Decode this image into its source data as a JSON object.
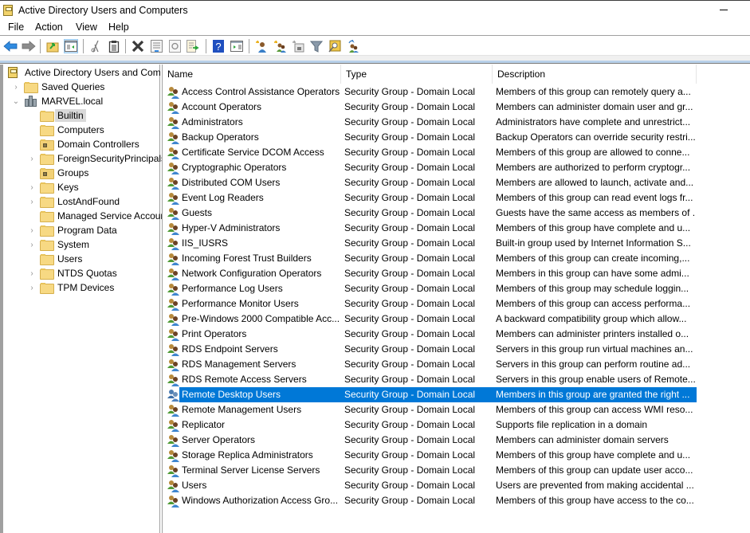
{
  "window": {
    "title": "Active Directory Users and Computers",
    "app_icon": "mmc-console-icon",
    "minimize_icon": "minimize-icon"
  },
  "menubar": {
    "items": [
      "File",
      "Action",
      "View",
      "Help"
    ]
  },
  "toolbar": {
    "buttons": [
      {
        "name": "back",
        "icon": "back-arrow-icon"
      },
      {
        "name": "forward",
        "icon": "forward-arrow-icon"
      },
      {
        "name": "up-one-level",
        "icon": "up-folder-icon"
      },
      {
        "name": "show-hide-console-tree",
        "icon": "console-tree-icon",
        "pressed": true
      },
      {
        "name": "cut",
        "icon": "scissors-icon"
      },
      {
        "name": "copy",
        "icon": "clipboard-icon"
      },
      {
        "name": "delete",
        "icon": "delete-x-icon"
      },
      {
        "name": "properties",
        "icon": "properties-icon"
      },
      {
        "name": "refresh",
        "icon": "refresh-icon"
      },
      {
        "name": "export-list",
        "icon": "export-list-icon"
      },
      {
        "name": "help",
        "icon": "help-icon"
      },
      {
        "name": "show-hide-action-pane",
        "icon": "action-pane-icon"
      },
      {
        "name": "create-user",
        "icon": "new-user-icon"
      },
      {
        "name": "create-group",
        "icon": "new-group-icon"
      },
      {
        "name": "create-ou",
        "icon": "new-ou-icon"
      },
      {
        "name": "filter",
        "icon": "filter-funnel-icon"
      },
      {
        "name": "find",
        "icon": "find-icon"
      },
      {
        "name": "add-to-group",
        "icon": "add-to-group-icon"
      }
    ]
  },
  "tree": {
    "root": "Active Directory Users and Com",
    "saved_queries": "Saved Queries",
    "domain": "MARVEL.local",
    "children": [
      {
        "label": "Builtin",
        "type": "container",
        "expandable": false,
        "selected": true
      },
      {
        "label": "Computers",
        "type": "container",
        "expandable": false
      },
      {
        "label": "Domain Controllers",
        "type": "ou",
        "expandable": false
      },
      {
        "label": "ForeignSecurityPrincipals",
        "type": "container",
        "expandable": true
      },
      {
        "label": "Groups",
        "type": "ou",
        "expandable": false
      },
      {
        "label": "Keys",
        "type": "container",
        "expandable": true
      },
      {
        "label": "LostAndFound",
        "type": "container",
        "expandable": true
      },
      {
        "label": "Managed Service Accour",
        "type": "container",
        "expandable": false
      },
      {
        "label": "Program Data",
        "type": "container",
        "expandable": true
      },
      {
        "label": "System",
        "type": "container",
        "expandable": true
      },
      {
        "label": "Users",
        "type": "container",
        "expandable": false
      },
      {
        "label": "NTDS Quotas",
        "type": "container",
        "expandable": true
      },
      {
        "label": "TPM Devices",
        "type": "container",
        "expandable": true
      }
    ]
  },
  "list": {
    "columns": [
      "Name",
      "Type",
      "Description"
    ],
    "selected_index": 20,
    "rows": [
      {
        "name": "Access Control Assistance Operators",
        "type": "Security Group - Domain Local",
        "description": "Members of this group can remotely query a..."
      },
      {
        "name": "Account Operators",
        "type": "Security Group - Domain Local",
        "description": "Members can administer domain user and gr..."
      },
      {
        "name": "Administrators",
        "type": "Security Group - Domain Local",
        "description": "Administrators have complete and unrestrict..."
      },
      {
        "name": "Backup Operators",
        "type": "Security Group - Domain Local",
        "description": "Backup Operators can override security restri..."
      },
      {
        "name": "Certificate Service DCOM Access",
        "type": "Security Group - Domain Local",
        "description": "Members of this group are allowed to conne..."
      },
      {
        "name": "Cryptographic Operators",
        "type": "Security Group - Domain Local",
        "description": "Members are authorized to perform cryptogr..."
      },
      {
        "name": "Distributed COM Users",
        "type": "Security Group - Domain Local",
        "description": "Members are allowed to launch, activate and..."
      },
      {
        "name": "Event Log Readers",
        "type": "Security Group - Domain Local",
        "description": "Members of this group can read event logs fr..."
      },
      {
        "name": "Guests",
        "type": "Security Group - Domain Local",
        "description": "Guests have the same access as members of ..."
      },
      {
        "name": "Hyper-V Administrators",
        "type": "Security Group - Domain Local",
        "description": "Members of this group have complete and u..."
      },
      {
        "name": "IIS_IUSRS",
        "type": "Security Group - Domain Local",
        "description": "Built-in group used by Internet Information S..."
      },
      {
        "name": "Incoming Forest Trust Builders",
        "type": "Security Group - Domain Local",
        "description": "Members of this group can create incoming,..."
      },
      {
        "name": "Network Configuration Operators",
        "type": "Security Group - Domain Local",
        "description": "Members in this group can have some admi..."
      },
      {
        "name": "Performance Log Users",
        "type": "Security Group - Domain Local",
        "description": "Members of this group may schedule loggin..."
      },
      {
        "name": "Performance Monitor Users",
        "type": "Security Group - Domain Local",
        "description": "Members of this group can access performa..."
      },
      {
        "name": "Pre-Windows 2000 Compatible Acc...",
        "type": "Security Group - Domain Local",
        "description": "A backward compatibility group which allow..."
      },
      {
        "name": "Print Operators",
        "type": "Security Group - Domain Local",
        "description": "Members can administer printers installed o..."
      },
      {
        "name": "RDS Endpoint Servers",
        "type": "Security Group - Domain Local",
        "description": "Servers in this group run virtual machines an..."
      },
      {
        "name": "RDS Management Servers",
        "type": "Security Group - Domain Local",
        "description": "Servers in this group can perform routine ad..."
      },
      {
        "name": "RDS Remote Access Servers",
        "type": "Security Group - Domain Local",
        "description": "Servers in this group enable users of Remote..."
      },
      {
        "name": "Remote Desktop Users",
        "type": "Security Group - Domain Local",
        "description": "Members in this group are granted the right ..."
      },
      {
        "name": "Remote Management Users",
        "type": "Security Group - Domain Local",
        "description": "Members of this group can access WMI reso..."
      },
      {
        "name": "Replicator",
        "type": "Security Group - Domain Local",
        "description": "Supports file replication in a domain"
      },
      {
        "name": "Server Operators",
        "type": "Security Group - Domain Local",
        "description": "Members can administer domain servers"
      },
      {
        "name": "Storage Replica Administrators",
        "type": "Security Group - Domain Local",
        "description": "Members of this group have complete and u..."
      },
      {
        "name": "Terminal Server License Servers",
        "type": "Security Group - Domain Local",
        "description": "Members of this group can update user acco..."
      },
      {
        "name": "Users",
        "type": "Security Group - Domain Local",
        "description": "Users are prevented from making accidental ..."
      },
      {
        "name": "Windows Authorization Access Gro...",
        "type": "Security Group - Domain Local",
        "description": "Members of this group have access to the co..."
      }
    ]
  },
  "colors": {
    "selection": "#0078d7",
    "tree_selection": "#d9d9d9",
    "pressed_button": "#cce4f7"
  }
}
